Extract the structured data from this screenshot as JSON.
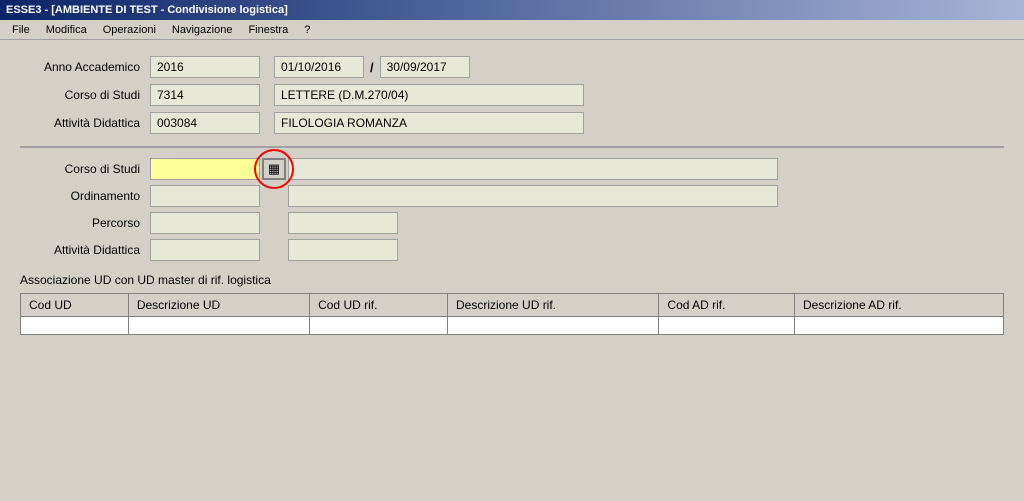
{
  "titleBar": {
    "text": "ESSE3 - [AMBIENTE DI TEST - Condivisione logistica]"
  },
  "menuBar": {
    "items": [
      "File",
      "Modifica",
      "Operazioni",
      "Navigazione",
      "Finestra",
      "?"
    ]
  },
  "infoSection": {
    "annoAccademicoLabel": "Anno Accademico",
    "annoAccademicoValue": "2016",
    "dateFrom": "01/10/2016",
    "dateSeparator": "/",
    "dateTo": "30/09/2017",
    "corsoDiStudiLabel": "Corso di Studi",
    "corsoDiStudiValue": "7314",
    "corsoDiStudiName": "LETTERE (D.M.270/04)",
    "attivitaDidatticaLabel": "Attività Didattica",
    "attivitaDidatticaCode": "003084",
    "attivitaDidatticaName": "FILOLOGIA ROMANZA"
  },
  "editSection": {
    "corsoDiStudiLabel": "Corso di Studi",
    "corsoDiStudiValue": "",
    "ordinamentoLabel": "Ordinamento",
    "ordinamentoValue": "",
    "percorsoLabel": "Percorso",
    "percorsoValue": "",
    "attivitaDidatticaLabel": "Attività Didattica",
    "attivitaDidatticaValue": "",
    "lookupIcon": "▦"
  },
  "assocSection": {
    "title": "Associazione UD con UD master di rif. logistica",
    "columns": [
      "Cod UD",
      "Descrizione UD",
      "Cod UD rif.",
      "Descrizione UD rif.",
      "Cod AD rif.",
      "Descrizione AD rif."
    ]
  }
}
